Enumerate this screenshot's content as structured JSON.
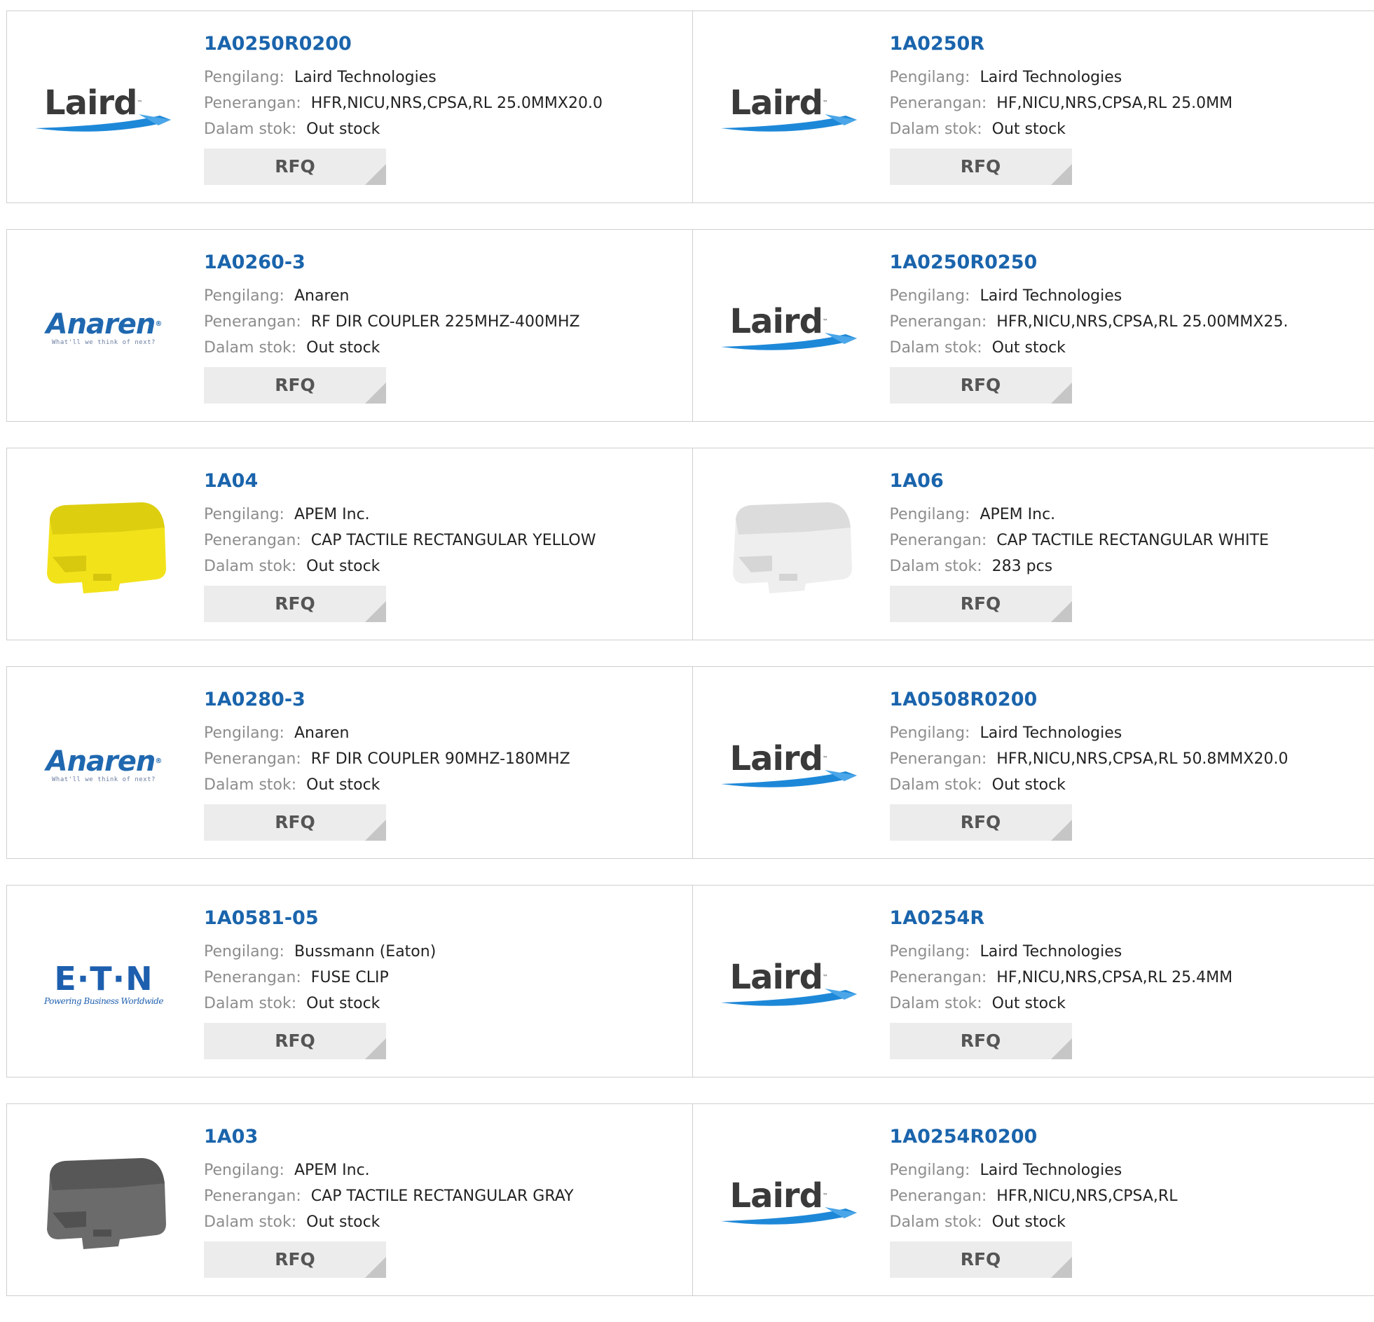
{
  "labels": {
    "manufacturer": "Pengilang:",
    "description": "Penerangan:",
    "stock": "Dalam stok:",
    "rfq": "RFQ"
  },
  "logos": {
    "laird": {
      "text": "Laird",
      "icon": "laird-swoosh-logo",
      "color": "#3a3a3a",
      "accent": "#1e88d8"
    },
    "anaren": {
      "text": "Anaren",
      "tagline": "What'll we think of next?",
      "color": "#1f68b0"
    },
    "eaton": {
      "text": "E·T·N",
      "tagline": "Powering Business Worldwide",
      "color": "#1d5fae"
    },
    "apem_yellow": {
      "icon": "yellow-tactile-cap-image",
      "color": "#f2e21a"
    },
    "apem_white": {
      "icon": "white-tactile-cap-image",
      "color": "#eeeeee"
    },
    "apem_gray": {
      "icon": "gray-tactile-cap-image",
      "color": "#6b6b6b"
    }
  },
  "products": [
    {
      "part": "1A0250R0200",
      "manufacturer": "Laird Technologies",
      "description": "HFR,NICU,NRS,CPSA,RL 25.0MMX20.0",
      "stock": "Out stock",
      "logo": "laird"
    },
    {
      "part": "1A0250R",
      "manufacturer": "Laird Technologies",
      "description": "HF,NICU,NRS,CPSA,RL 25.0MM",
      "stock": "Out stock",
      "logo": "laird"
    },
    {
      "part": "1A0260-3",
      "manufacturer": "Anaren",
      "description": "RF DIR COUPLER 225MHZ-400MHZ",
      "stock": "Out stock",
      "logo": "anaren"
    },
    {
      "part": "1A0250R0250",
      "manufacturer": "Laird Technologies",
      "description": "HFR,NICU,NRS,CPSA,RL 25.00MMX25.",
      "stock": "Out stock",
      "logo": "laird"
    },
    {
      "part": "1A04",
      "manufacturer": "APEM Inc.",
      "description": "CAP TACTILE RECTANGULAR YELLOW",
      "stock": "Out stock",
      "logo": "apem_yellow"
    },
    {
      "part": "1A06",
      "manufacturer": "APEM Inc.",
      "description": "CAP TACTILE RECTANGULAR WHITE",
      "stock": "283 pcs",
      "logo": "apem_white"
    },
    {
      "part": "1A0280-3",
      "manufacturer": "Anaren",
      "description": "RF DIR COUPLER 90MHZ-180MHZ",
      "stock": "Out stock",
      "logo": "anaren"
    },
    {
      "part": "1A0508R0200",
      "manufacturer": "Laird Technologies",
      "description": "HFR,NICU,NRS,CPSA,RL 50.8MMX20.0",
      "stock": "Out stock",
      "logo": "laird"
    },
    {
      "part": "1A0581-05",
      "manufacturer": "Bussmann (Eaton)",
      "description": "FUSE CLIP",
      "stock": "Out stock",
      "logo": "eaton"
    },
    {
      "part": "1A0254R",
      "manufacturer": "Laird Technologies",
      "description": "HF,NICU,NRS,CPSA,RL 25.4MM",
      "stock": "Out stock",
      "logo": "laird"
    },
    {
      "part": "1A03",
      "manufacturer": "APEM Inc.",
      "description": "CAP TACTILE RECTANGULAR GRAY",
      "stock": "Out stock",
      "logo": "apem_gray"
    },
    {
      "part": "1A0254R0200",
      "manufacturer": "Laird Technologies",
      "description": "HFR,NICU,NRS,CPSA,RL",
      "stock": "Out stock",
      "logo": "laird"
    }
  ]
}
